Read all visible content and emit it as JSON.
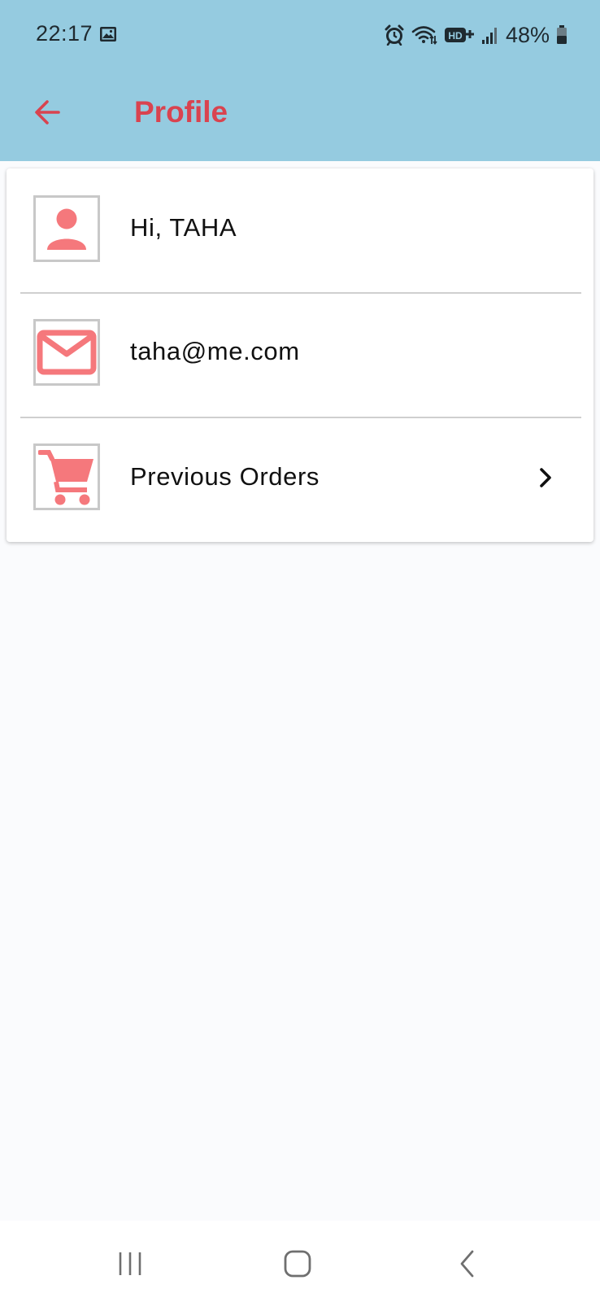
{
  "colors": {
    "header_bg": "#95cbe0",
    "accent_red": "#d9434f",
    "icon_pink": "#f5787c",
    "page_bg": "#fafbfd"
  },
  "status_bar": {
    "time": "22:17",
    "battery": "48%",
    "icons": [
      "image-icon",
      "alarm-icon",
      "wifi-icon",
      "hd-plus-icon",
      "signal-icon",
      "battery-icon"
    ]
  },
  "header": {
    "title": "Profile",
    "back_icon": "arrow-left-icon"
  },
  "profile_rows": [
    {
      "icon": "person-icon",
      "label": "Hi, TAHA"
    },
    {
      "icon": "mail-icon",
      "label": "taha@me.com"
    },
    {
      "icon": "cart-icon",
      "label": "Previous Orders",
      "trailing_icon": "chevron-right-icon"
    }
  ],
  "nav_bar": {
    "buttons": [
      "recent-apps-icon",
      "home-icon",
      "back-icon"
    ]
  }
}
